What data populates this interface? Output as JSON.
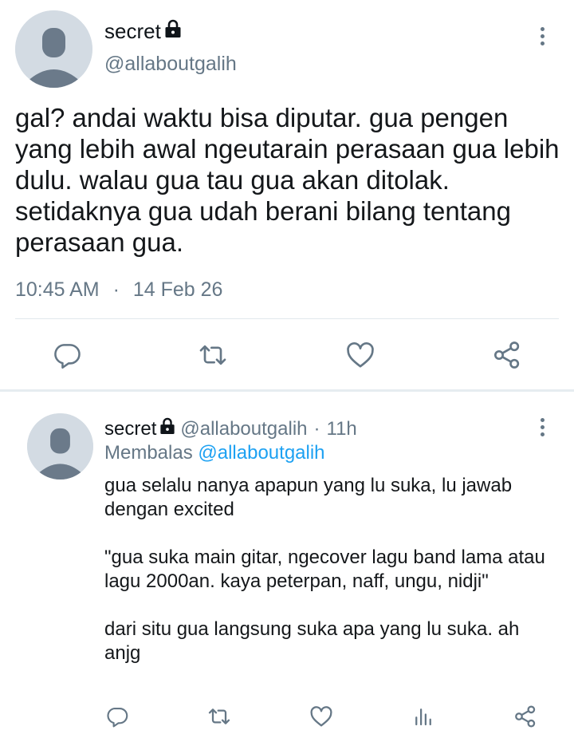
{
  "main_tweet": {
    "display_name": "secret",
    "handle": "@allaboutgalih",
    "text": "gal? andai waktu bisa diputar. gua pengen yang lebih awal ngeutarain perasaan gua lebih dulu. walau gua tau gua akan ditolak. setidaknya gua udah berani bilang tentang perasaan gua.",
    "time": "10:45 AM",
    "separator": "·",
    "date": "14 Feb 26",
    "icons": [
      "reply-icon",
      "retweet-icon",
      "like-icon",
      "share-icon"
    ]
  },
  "reply_tweet": {
    "display_name": "secret",
    "handle": "@allaboutgalih",
    "separator": "·",
    "relative_time": "11h",
    "replying_prefix": "Membalas",
    "replying_to": "@allaboutgalih",
    "text": "gua selalu nanya apapun yang lu suka, lu jawab dengan excited\n\n\"gua suka main gitar, ngecover lagu band lama atau lagu 2000an. kaya peterpan, naff, ungu, nidji\"\n\ndari situ gua langsung suka apa yang lu suka. ah anjg",
    "icons": [
      "reply-icon",
      "retweet-icon",
      "like-icon",
      "analytics-icon",
      "share-icon"
    ]
  },
  "colors": {
    "text": "#14171a",
    "secondary": "#657786",
    "link": "#1da1f2",
    "divider": "#e1e8ed",
    "avatar_bg": "#d3dbe3",
    "avatar_fg": "#6b7a8a"
  }
}
